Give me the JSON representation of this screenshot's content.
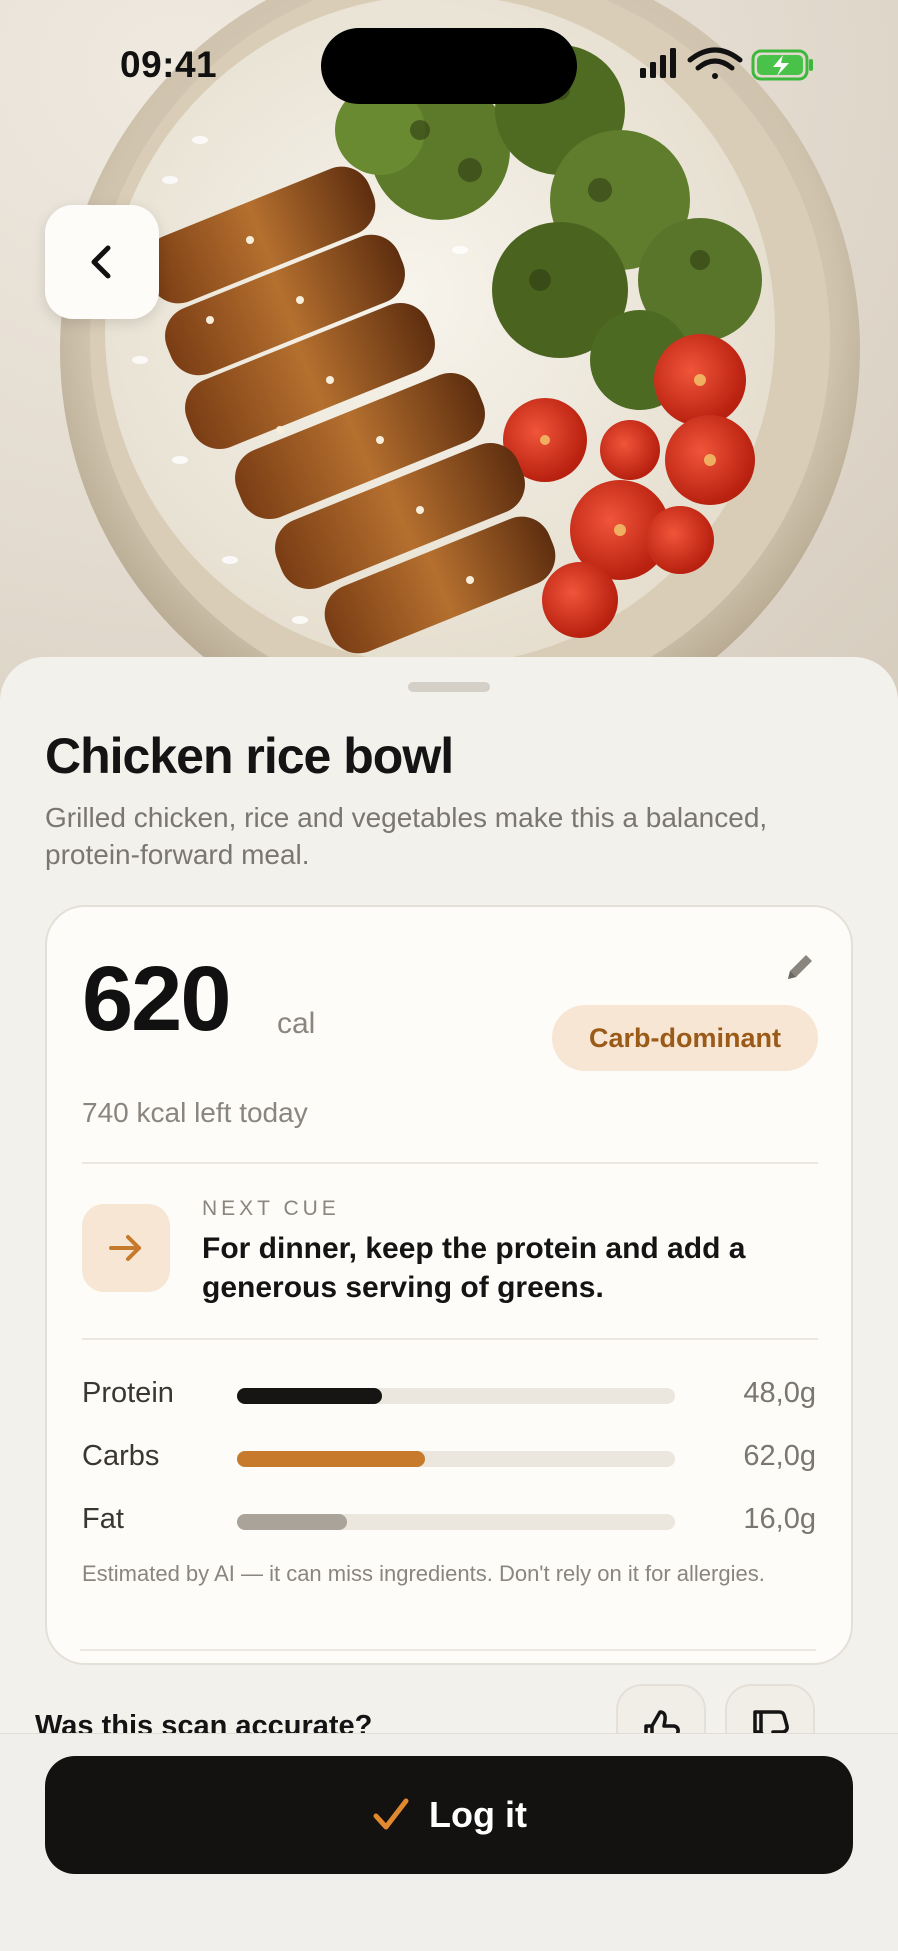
{
  "status_bar": {
    "time": "09:41"
  },
  "meal": {
    "title": "Chicken rice bowl",
    "description": "Grilled chicken, rice and vegetables make this a balanced, protein-forward meal."
  },
  "summary": {
    "calories": "620",
    "unit": "cal",
    "badge": "Carb-dominant",
    "remaining": "740 kcal left today"
  },
  "cue": {
    "label": "NEXT CUE",
    "text": "For dinner, keep the protein and add a generous serving of greens."
  },
  "macros": [
    {
      "name": "Protein",
      "value": "48,0g",
      "fill_fraction": 0.33,
      "color": "#161514"
    },
    {
      "name": "Carbs",
      "value": "62,0g",
      "fill_fraction": 0.43,
      "color": "#c77a2c"
    },
    {
      "name": "Fat",
      "value": "16,0g",
      "fill_fraction": 0.25,
      "color": "#a9a399"
    }
  ],
  "disclaimer": "Estimated by AI — it can miss ingredients. Don't rely on it for allergies.",
  "feedback": {
    "question": "Was this scan accurate?"
  },
  "actions": {
    "log_label": "Log it"
  },
  "colors": {
    "accent": "#c77a2c",
    "badge_bg": "#f8e6d4",
    "badge_text": "#9a5a18",
    "primary_button": "#141210"
  }
}
